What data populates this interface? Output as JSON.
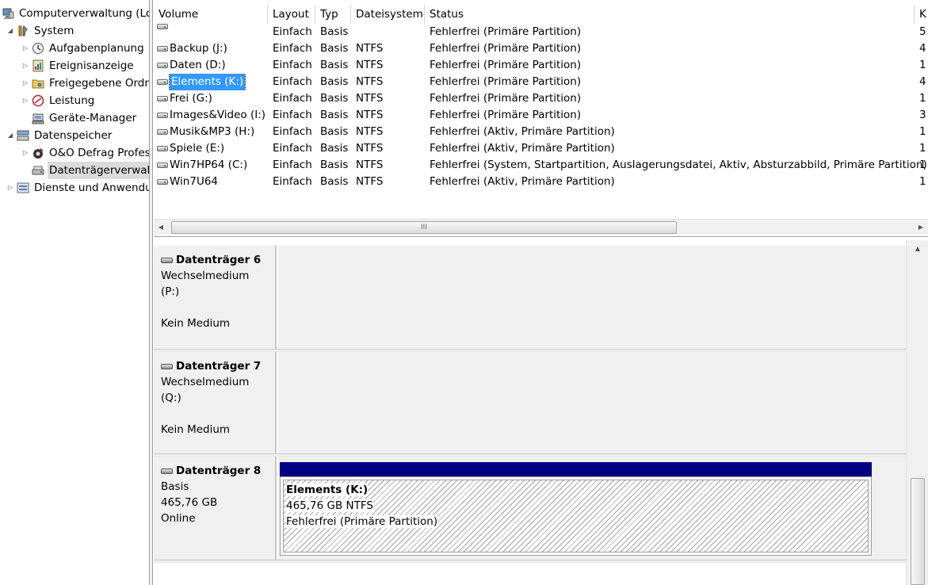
{
  "tree": {
    "root": "Computerverwaltung (Lokal)",
    "system": "System",
    "aufgaben": "Aufgabenplanung",
    "ereignis": "Ereignisanzeige",
    "freigabe": "Freigegebene Ordner",
    "leistung": "Leistung",
    "geraete": "Geräte-Manager",
    "datenspeicher": "Datenspeicher",
    "defrag": "O&O Defrag Professional",
    "datentraeger": "Datenträgerverwaltung",
    "dienste": "Dienste und Anwendungen"
  },
  "columns": {
    "volume": "Volume",
    "layout": "Layout",
    "typ": "Typ",
    "fs": "Dateisystem",
    "status": "Status",
    "more": "K"
  },
  "volumes": [
    {
      "name": "",
      "layout": "Einfach",
      "typ": "Basis",
      "fs": "",
      "status": "Fehlerfrei (Primäre Partition)",
      "end": "5"
    },
    {
      "name": "Backup (J:)",
      "layout": "Einfach",
      "typ": "Basis",
      "fs": "NTFS",
      "status": "Fehlerfrei (Primäre Partition)",
      "end": "4"
    },
    {
      "name": "Daten (D:)",
      "layout": "Einfach",
      "typ": "Basis",
      "fs": "NTFS",
      "status": "Fehlerfrei (Primäre Partition)",
      "end": "1"
    },
    {
      "name": "Elements (K:)",
      "layout": "Einfach",
      "typ": "Basis",
      "fs": "NTFS",
      "status": "Fehlerfrei (Primäre Partition)",
      "end": "4"
    },
    {
      "name": "Frei (G:)",
      "layout": "Einfach",
      "typ": "Basis",
      "fs": "NTFS",
      "status": "Fehlerfrei (Primäre Partition)",
      "end": "1"
    },
    {
      "name": "Images&Video (I:)",
      "layout": "Einfach",
      "typ": "Basis",
      "fs": "NTFS",
      "status": "Fehlerfrei (Primäre Partition)",
      "end": "3"
    },
    {
      "name": "Musik&MP3 (H:)",
      "layout": "Einfach",
      "typ": "Basis",
      "fs": "NTFS",
      "status": "Fehlerfrei (Aktiv, Primäre Partition)",
      "end": "1"
    },
    {
      "name": "Spiele (E:)",
      "layout": "Einfach",
      "typ": "Basis",
      "fs": "NTFS",
      "status": "Fehlerfrei (Aktiv, Primäre Partition)",
      "end": "1"
    },
    {
      "name": "Win7HP64 (C:)",
      "layout": "Einfach",
      "typ": "Basis",
      "fs": "NTFS",
      "status": "Fehlerfrei (System, Startpartition, Auslagerungsdatei, Aktiv, Absturzabbild, Primäre Partition)",
      "end": "1"
    },
    {
      "name": "Win7U64",
      "layout": "Einfach",
      "typ": "Basis",
      "fs": "NTFS",
      "status": "Fehlerfrei (Aktiv, Primäre Partition)",
      "end": "1"
    }
  ],
  "scroll_grip": "III",
  "disks": {
    "d6": {
      "title": "Datenträger 6",
      "line1": "Wechselmedium (P:)",
      "line2": "",
      "line3": "Kein Medium"
    },
    "d7": {
      "title": "Datenträger 7",
      "line1": "Wechselmedium (Q:)",
      "line2": "",
      "line3": "Kein Medium"
    },
    "d8": {
      "title": "Datenträger 8",
      "line1": "Basis",
      "line2": "465,76 GB",
      "line3": "Online",
      "partition": {
        "name": "Elements  (K:)",
        "size": "465,76 GB NTFS",
        "status": "Fehlerfrei (Primäre Partition)"
      }
    }
  },
  "colors": {
    "selection": "#3399ff",
    "partition_bar": "#000080"
  }
}
